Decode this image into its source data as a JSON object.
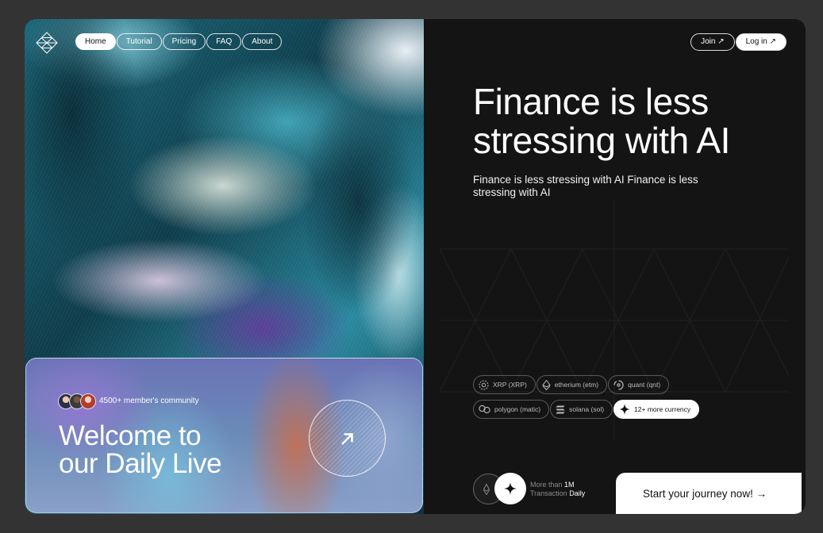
{
  "nav": {
    "items": [
      {
        "label": "Home",
        "active": true
      },
      {
        "label": "Tutorial",
        "active": false
      },
      {
        "label": "Pricing",
        "active": false
      },
      {
        "label": "FAQ",
        "active": false
      },
      {
        "label": "About",
        "active": false
      }
    ]
  },
  "auth": {
    "join_label": "Join ↗",
    "login_label": "Log in ↗"
  },
  "hero": {
    "community": "4500+ member's community",
    "welcome_line1": "Welcome to",
    "welcome_line2": "our Daily Live"
  },
  "main": {
    "headline_line1": "Finance is less",
    "headline_line2": "stressing with AI",
    "subtext": "Finance is less stressing with AI Finance is less stressing with AI"
  },
  "currencies": [
    {
      "label": "XRP (XRP)",
      "icon": "xrp-icon"
    },
    {
      "label": "etherium (etm)",
      "icon": "ethereum-icon"
    },
    {
      "label": "quant (qnt)",
      "icon": "quant-icon"
    },
    {
      "label": "polygon (matic)",
      "icon": "polygon-icon"
    },
    {
      "label": "solana (sol)",
      "icon": "solana-icon"
    },
    {
      "label": "12+ more currency",
      "icon": "sparkle-icon"
    }
  ],
  "stats": {
    "prefix1": "More than ",
    "value": "1M",
    "prefix2": "Transaction ",
    "suffix": "Daily"
  },
  "cta": {
    "label": "Start your journey now! →"
  },
  "colors": {
    "background": "#333333",
    "panel": "#141414",
    "accent": "#ffffff"
  }
}
